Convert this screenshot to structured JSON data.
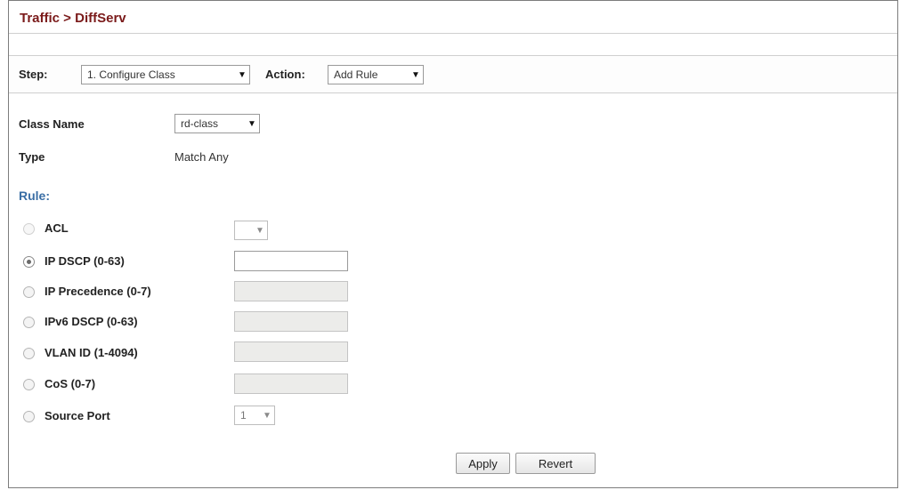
{
  "breadcrumb": "Traffic > DiffServ",
  "step_bar": {
    "step_label": "Step:",
    "step_value": "1. Configure Class",
    "action_label": "Action:",
    "action_value": "Add Rule"
  },
  "form": {
    "class_name_label": "Class Name",
    "class_name_value": "rd-class",
    "type_label": "Type",
    "type_value": "Match Any",
    "rule_heading": "Rule:",
    "rules": [
      {
        "label": "ACL",
        "control": "select",
        "value": "",
        "selected": false,
        "enabled": false
      },
      {
        "label": "IP DSCP (0-63)",
        "control": "text",
        "value": "",
        "selected": true,
        "enabled": true
      },
      {
        "label": "IP Precedence (0-7)",
        "control": "text",
        "value": "",
        "selected": false,
        "enabled": false
      },
      {
        "label": "IPv6 DSCP (0-63)",
        "control": "text",
        "value": "",
        "selected": false,
        "enabled": false
      },
      {
        "label": "VLAN ID (1-4094)",
        "control": "text",
        "value": "",
        "selected": false,
        "enabled": false
      },
      {
        "label": "CoS (0-7)",
        "control": "text",
        "value": "",
        "selected": false,
        "enabled": false
      },
      {
        "label": "Source Port",
        "control": "select",
        "value": "1",
        "selected": false,
        "enabled": false
      }
    ]
  },
  "buttons": {
    "apply": "Apply",
    "revert": "Revert"
  },
  "icons": {
    "dropdown": "chevron-down-icon",
    "radio": "radio-icon"
  },
  "colors": {
    "title": "#7a1a1a",
    "rule_heading": "#3a6ea5"
  }
}
